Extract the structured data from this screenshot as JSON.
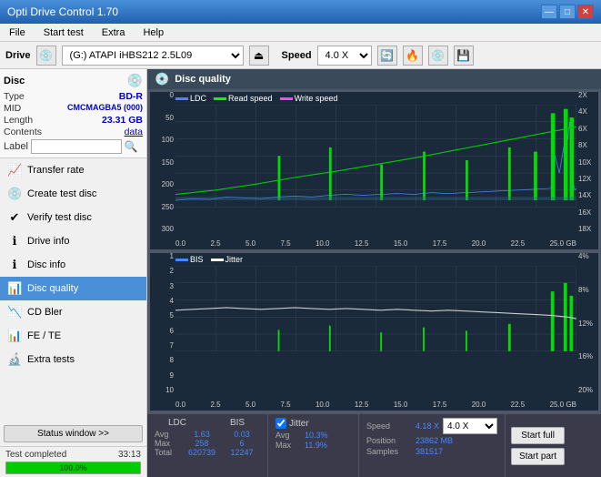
{
  "app": {
    "title": "Opti Drive Control 1.70",
    "title_icon": "💿"
  },
  "titlebar": {
    "minimize": "—",
    "maximize": "□",
    "close": "✕"
  },
  "menu": {
    "items": [
      "File",
      "Start test",
      "Extra",
      "Help"
    ]
  },
  "drivebar": {
    "drive_label": "Drive",
    "drive_value": "(G:) ATAPI iHBS212  2.5L09",
    "speed_label": "Speed",
    "speed_value": "4.0 X"
  },
  "disc": {
    "title": "Disc",
    "type_label": "Type",
    "type_value": "BD-R",
    "mid_label": "MID",
    "mid_value": "CMCMAGBA5 (000)",
    "length_label": "Length",
    "length_value": "23.31 GB",
    "contents_label": "Contents",
    "contents_value": "data",
    "label_label": "Label"
  },
  "nav": {
    "items": [
      {
        "id": "transfer-rate",
        "label": "Transfer rate",
        "icon": "📈"
      },
      {
        "id": "create-test-disc",
        "label": "Create test disc",
        "icon": "💿"
      },
      {
        "id": "verify-test-disc",
        "label": "Verify test disc",
        "icon": "✔"
      },
      {
        "id": "drive-info",
        "label": "Drive info",
        "icon": "ℹ"
      },
      {
        "id": "disc-info",
        "label": "Disc info",
        "icon": "ℹ"
      },
      {
        "id": "disc-quality",
        "label": "Disc quality",
        "icon": "📊",
        "active": true
      },
      {
        "id": "cd-bler",
        "label": "CD Bler",
        "icon": "📉"
      },
      {
        "id": "fe-te",
        "label": "FE / TE",
        "icon": "📊"
      },
      {
        "id": "extra-tests",
        "label": "Extra tests",
        "icon": "🔬"
      }
    ]
  },
  "status_window_btn": "Status window >>",
  "progress": {
    "value": 100,
    "label": "100.0%",
    "status_text": "Test completed",
    "time": "33:13"
  },
  "chart": {
    "title": "Disc quality",
    "top_legend": [
      {
        "label": "LDC",
        "color": "#4488ff"
      },
      {
        "label": "Read speed",
        "color": "#00ff00"
      },
      {
        "label": "Write speed",
        "color": "#ff44ff"
      }
    ],
    "top_y_labels": [
      "0",
      "50",
      "100",
      "150",
      "200",
      "250",
      "300"
    ],
    "top_y_labels_right": [
      "2X",
      "4X",
      "6X",
      "8X",
      "10X",
      "12X",
      "14X",
      "16X",
      "18X"
    ],
    "bottom_legend": [
      {
        "label": "BIS",
        "color": "#4488ff"
      },
      {
        "label": "Jitter",
        "color": "#ffffff"
      }
    ],
    "bottom_y_labels": [
      "1",
      "2",
      "3",
      "4",
      "5",
      "6",
      "7",
      "8",
      "9",
      "10"
    ],
    "bottom_y_labels_right": [
      "4%",
      "8%",
      "12%",
      "16%",
      "20%"
    ],
    "x_labels": [
      "0.0",
      "2.5",
      "5.0",
      "7.5",
      "10.0",
      "12.5",
      "15.0",
      "17.5",
      "20.0",
      "22.5",
      "25.0"
    ],
    "x_label_gb": "GB"
  },
  "stats": {
    "ldc_header": "LDC",
    "bis_header": "BIS",
    "avg_label": "Avg",
    "max_label": "Max",
    "total_label": "Total",
    "ldc_avg": "1.63",
    "ldc_max": "258",
    "ldc_total": "620739",
    "bis_avg": "0.03",
    "bis_max": "6",
    "bis_total": "12247",
    "jitter_avg": "10.3%",
    "jitter_max": "11.9%",
    "speed_label": "Speed",
    "speed_value": "4.18 X",
    "position_label": "Position",
    "position_value": "23862 MB",
    "samples_label": "Samples",
    "samples_value": "381517",
    "speed_select": "4.0 X",
    "btn_start_full": "Start full",
    "btn_start_part": "Start part"
  }
}
